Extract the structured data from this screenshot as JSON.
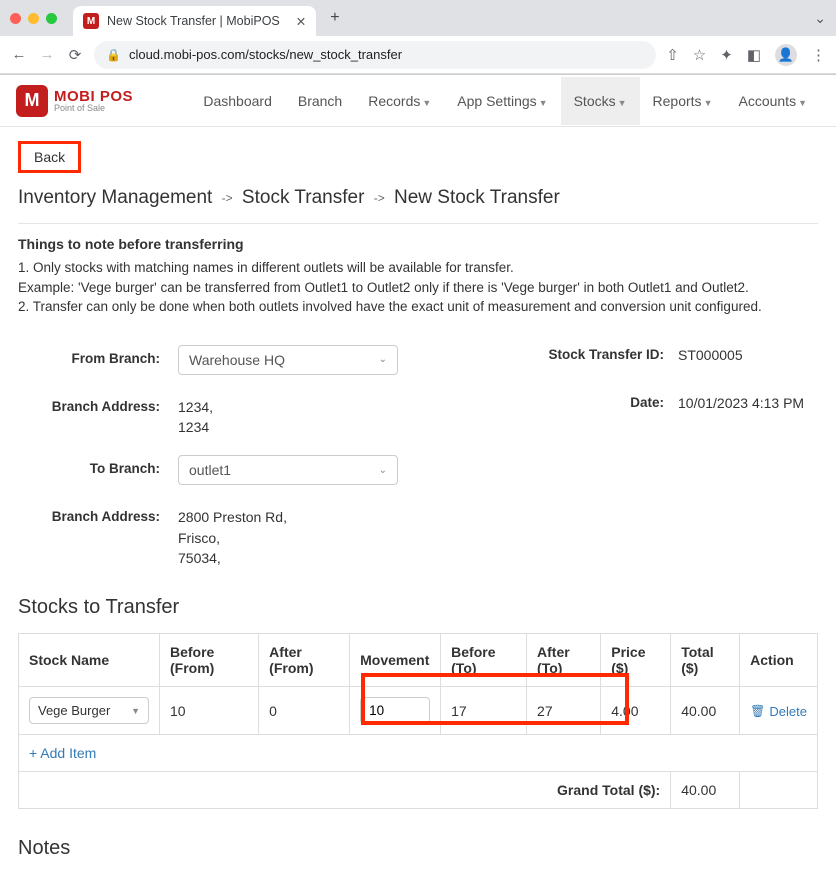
{
  "chrome": {
    "tab_title": "New Stock Transfer | MobiPOS",
    "url": "cloud.mobi-pos.com/stocks/new_stock_transfer"
  },
  "logo": {
    "main": "MOBI POS",
    "sub": "Point of Sale",
    "mark": "M"
  },
  "nav": {
    "dashboard": "Dashboard",
    "branch": "Branch",
    "records": "Records",
    "app_settings": "App Settings",
    "stocks": "Stocks",
    "reports": "Reports",
    "accounts": "Accounts"
  },
  "back_label": "Back",
  "breadcrumb": {
    "a": "Inventory Management",
    "b": "Stock Transfer",
    "c": "New Stock Transfer"
  },
  "things": {
    "heading": "Things to note before transferring",
    "l1": "1. Only stocks with matching names in different outlets will be available for transfer.",
    "l2": "Example: 'Vege burger' can be transferred from Outlet1 to Outlet2 only if there is 'Vege burger' in both Outlet1 and Outlet2.",
    "l3": "2. Transfer can only be done when both outlets involved have the exact unit of measurement and conversion unit configured."
  },
  "form": {
    "from_branch_label": "From Branch:",
    "from_branch_value": "Warehouse HQ",
    "branch_addr_label": "Branch Address:",
    "from_addr_l1": "1234,",
    "from_addr_l2": "1234",
    "to_branch_label": "To Branch:",
    "to_branch_value": "outlet1",
    "to_addr_l1": "2800 Preston Rd,",
    "to_addr_l2": "Frisco,",
    "to_addr_l3": "75034,",
    "transfer_id_label": "Stock Transfer ID:",
    "transfer_id_value": "ST000005",
    "date_label": "Date:",
    "date_value": "10/01/2023 4:13 PM"
  },
  "stocks_title": "Stocks to Transfer",
  "table": {
    "h_stock": "Stock Name",
    "h_before_from": "Before (From)",
    "h_after_from": "After (From)",
    "h_movement": "Movement",
    "h_before_to": "Before (To)",
    "h_after_to": "After (To)",
    "h_price": "Price ($)",
    "h_total": "Total ($)",
    "h_action": "Action",
    "row": {
      "stock_name": "Vege Burger",
      "before_from": "10",
      "after_from": "0",
      "movement": "10",
      "before_to": "17",
      "after_to": "27",
      "price": "4.00",
      "total": "40.00",
      "delete": "Delete"
    },
    "add_item": "+ Add Item",
    "grand_label": "Grand Total ($):",
    "grand_value": "40.00"
  },
  "notes_title": "Notes"
}
